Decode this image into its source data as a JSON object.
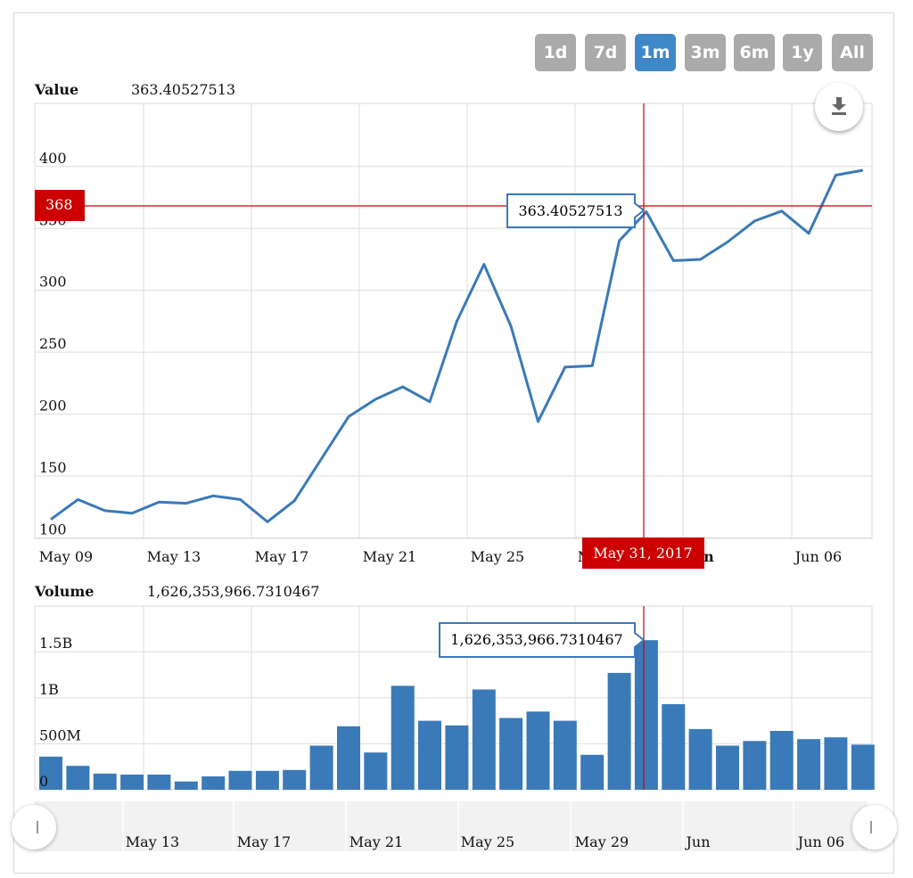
{
  "range_buttons": [
    {
      "label": "1d",
      "active": false
    },
    {
      "label": "7d",
      "active": false
    },
    {
      "label": "1m",
      "active": true
    },
    {
      "label": "3m",
      "active": false
    },
    {
      "label": "6m",
      "active": false
    },
    {
      "label": "1y",
      "active": false
    },
    {
      "label": "All",
      "active": false
    }
  ],
  "value_panel": {
    "label": "Value",
    "readout": "363.40527513"
  },
  "volume_panel": {
    "label": "Volume",
    "readout": "1,626,353,966.7310467"
  },
  "crosshair": {
    "y_value_label": "368",
    "date_label": "May 31, 2017",
    "value_tooltip": "363.40527513",
    "volume_tooltip": "1,626,353,966.7310467"
  },
  "navigator": {
    "x_labels": [
      "May 13",
      "May 17",
      "May 21",
      "May 25",
      "May 29",
      "Jun",
      "Jun 06"
    ]
  },
  "colors": {
    "series": "#3a7ab8",
    "crosshair": "#cc0000",
    "button": "#aaaaaa",
    "button_active": "#3f88c8"
  },
  "icons": {
    "export": "download-icon"
  },
  "chart_data": [
    {
      "type": "line",
      "title": "Value",
      "x": [
        "May 09",
        "May 10",
        "May 11",
        "May 12",
        "May 13",
        "May 14",
        "May 15",
        "May 16",
        "May 17",
        "May 18",
        "May 19",
        "May 20",
        "May 21",
        "May 22",
        "May 23",
        "May 24",
        "May 25",
        "May 26",
        "May 27",
        "May 28",
        "May 29",
        "May 30",
        "May 31",
        "Jun 01",
        "Jun 02",
        "Jun 03",
        "Jun 04",
        "Jun 05",
        "Jun 06",
        "Jun 07",
        "Jun 08"
      ],
      "values": [
        115,
        131,
        122,
        120,
        129,
        128,
        134,
        131,
        113,
        130,
        164,
        198,
        212,
        222,
        210,
        275,
        321,
        271,
        194,
        238,
        239,
        340,
        363.40527513,
        324,
        325,
        339,
        356,
        364,
        346,
        393,
        397
      ],
      "x_tick_labels": [
        "May 09",
        "May 13",
        "May 17",
        "May 21",
        "May 25",
        "M",
        "n",
        "Jun 06"
      ],
      "y_tick_labels": [
        "100",
        "150",
        "200",
        "250",
        "300",
        "350",
        "400"
      ],
      "ylim": [
        100,
        450
      ],
      "grid": true
    },
    {
      "type": "bar",
      "title": "Volume",
      "categories": [
        "May 09",
        "May 10",
        "May 11",
        "May 12",
        "May 13",
        "May 14",
        "May 15",
        "May 16",
        "May 17",
        "May 18",
        "May 19",
        "May 20",
        "May 21",
        "May 22",
        "May 23",
        "May 24",
        "May 25",
        "May 26",
        "May 27",
        "May 28",
        "May 29",
        "May 30",
        "May 31",
        "Jun 01",
        "Jun 02",
        "Jun 03",
        "Jun 04",
        "Jun 05",
        "Jun 06",
        "Jun 07",
        "Jun 08"
      ],
      "values": [
        360000000,
        260000000,
        175000000,
        165000000,
        165000000,
        90000000,
        145000000,
        205000000,
        205000000,
        215000000,
        480000000,
        690000000,
        405000000,
        1130000000,
        750000000,
        700000000,
        1090000000,
        780000000,
        850000000,
        750000000,
        380000000,
        1270000000,
        1626353966.7310467,
        930000000,
        660000000,
        480000000,
        530000000,
        640000000,
        550000000,
        570000000,
        490000000
      ],
      "y_tick_labels": [
        "0",
        "500M",
        "1B",
        "1.5B"
      ],
      "ylim": [
        0,
        2000000000
      ],
      "grid": true
    }
  ]
}
